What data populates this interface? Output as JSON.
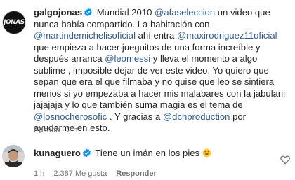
{
  "comments": [
    {
      "username": "galgojonas",
      "avatar_text": "JONAS",
      "verified": true,
      "segments": [
        {
          "text": "Mundial 2010 ",
          "mention": false
        },
        {
          "text": "@afaseleccion",
          "mention": true
        },
        {
          "text": " un video que nunca había compartido. La habitación con ",
          "mention": false
        },
        {
          "text": "@martindemichelisoficial",
          "mention": true
        },
        {
          "text": " ahí entra ",
          "mention": false
        },
        {
          "text": "@maxirodriguez11oficial",
          "mention": true
        },
        {
          "text": " que empieza a hacer jueguitos de una forma increíble y después arranca ",
          "mention": false
        },
        {
          "text": "@leomessi",
          "mention": true
        },
        {
          "text": " y lleva el momento a algo sublime , imposible dejar de ver este video. Yo quiero que sepan que era el que filmaba y no quise que leo se sintiera menos si yo empezaba a hacer mis malabares con la jabulani jajajaja y lo que también suma magia es el tema de ",
          "mention": false
        },
        {
          "text": "@losnocherosofic",
          "mention": true
        },
        {
          "text": " . Y gracias a ",
          "mention": false
        },
        {
          "text": "@dchproduction",
          "mention": true
        },
        {
          "text": " por ayudarme en esto.",
          "mention": false
        }
      ],
      "meta": "Editado · 2 h"
    },
    {
      "username": "kunaguero",
      "verified": true,
      "text": "Tiene un imán en los pies",
      "emoji": "smiling-face-with-heart-eyes",
      "meta": {
        "time": "1 h",
        "likes": "2.387 Me gusta",
        "reply": "Responder"
      }
    }
  ],
  "colors": {
    "text": "#262626",
    "mention": "#2f5d99",
    "meta": "#737373",
    "verified": "#0095f6"
  }
}
